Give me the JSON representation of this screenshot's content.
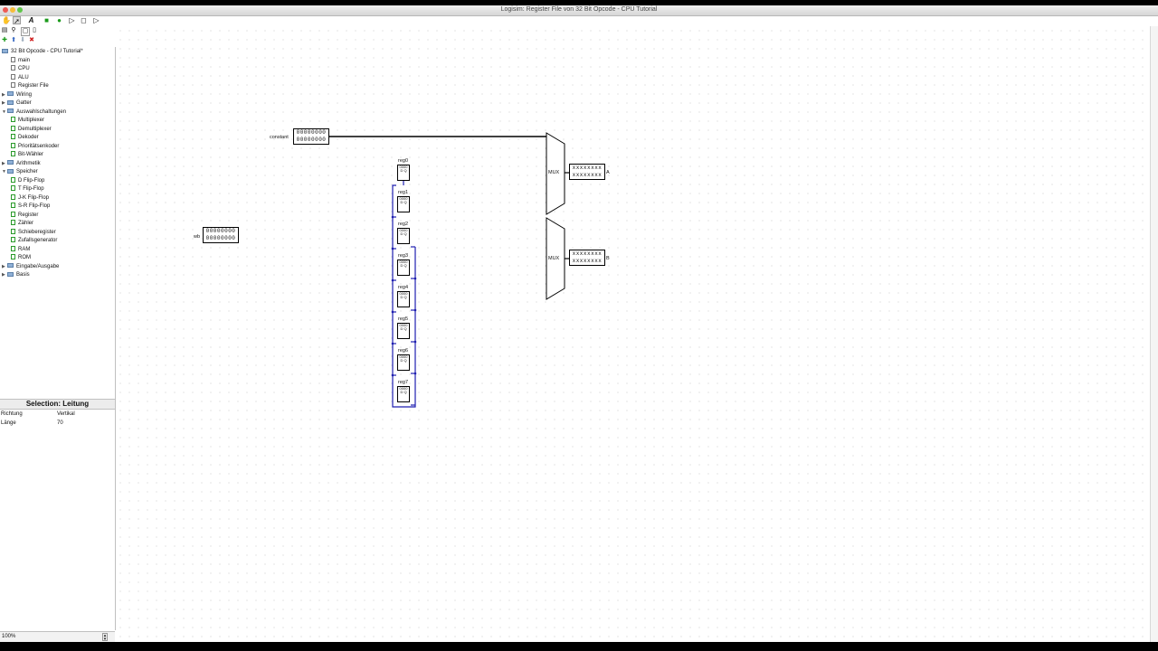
{
  "window": {
    "title": "Logisim: Register File von 32 Bit Opcode - CPU Tutorial"
  },
  "colors": {
    "close": "#ee5b55",
    "minimize": "#f6bd3a",
    "zoom": "#5fc64a",
    "wire": "#000000",
    "bus_wire": "#1f1fb0",
    "folder": "#8fb0d6"
  },
  "toolbar": [
    {
      "icon": "poke-hand-icon"
    },
    {
      "icon": "select-arrow-icon"
    },
    {
      "icon": "text-tool-icon"
    },
    {
      "icon": "input-pin-icon"
    },
    {
      "icon": "output-pin-icon"
    },
    {
      "icon": "not-gate-icon"
    },
    {
      "icon": "and-gate-icon"
    },
    {
      "icon": "or-gate-icon"
    }
  ],
  "explorer": {
    "items": [
      {
        "label": "32 Bit Opcode - CPU Tutorial*",
        "level": 0,
        "kind": "project",
        "expanded": true
      },
      {
        "label": "main",
        "level": 1,
        "kind": "circuit"
      },
      {
        "label": "CPU",
        "level": 1,
        "kind": "circuit"
      },
      {
        "label": "ALU",
        "level": 1,
        "kind": "circuit"
      },
      {
        "label": "Register File",
        "level": 1,
        "kind": "circuit-open"
      },
      {
        "label": "Wiring",
        "level": 0,
        "kind": "folder"
      },
      {
        "label": "Gatter",
        "level": 0,
        "kind": "folder"
      },
      {
        "label": "Auswahlschaltungen",
        "level": 0,
        "kind": "folder",
        "expanded": true
      },
      {
        "label": "Multiplexer",
        "level": 1,
        "kind": "component"
      },
      {
        "label": "Demultiplexer",
        "level": 1,
        "kind": "component"
      },
      {
        "label": "Dekoder",
        "level": 1,
        "kind": "component"
      },
      {
        "label": "Prioritätsenkoder",
        "level": 1,
        "kind": "component"
      },
      {
        "label": "Bit-Wähler",
        "level": 1,
        "kind": "component"
      },
      {
        "label": "Arithmetik",
        "level": 0,
        "kind": "folder"
      },
      {
        "label": "Speicher",
        "level": 0,
        "kind": "folder",
        "expanded": true
      },
      {
        "label": "D Flip-Flop",
        "level": 1,
        "kind": "component"
      },
      {
        "label": "T Flip-Flop",
        "level": 1,
        "kind": "component"
      },
      {
        "label": "J-K Flip-Flop",
        "level": 1,
        "kind": "component"
      },
      {
        "label": "S-R Flip-Flop",
        "level": 1,
        "kind": "component"
      },
      {
        "label": "Register",
        "level": 1,
        "kind": "component"
      },
      {
        "label": "Zähler",
        "level": 1,
        "kind": "component"
      },
      {
        "label": "Schieberegister",
        "level": 1,
        "kind": "component"
      },
      {
        "label": "Zufallsgenerator",
        "level": 1,
        "kind": "component"
      },
      {
        "label": "RAM",
        "level": 1,
        "kind": "component"
      },
      {
        "label": "ROM",
        "level": 1,
        "kind": "component"
      },
      {
        "label": "Eingabe/Ausgabe",
        "level": 0,
        "kind": "folder"
      },
      {
        "label": "Basis",
        "level": 0,
        "kind": "folder"
      }
    ]
  },
  "properties": {
    "header": "Selection: Leitung",
    "rows": [
      {
        "key": "Richtung",
        "value": "Vertikal"
      },
      {
        "key": "Länge",
        "value": "70"
      }
    ]
  },
  "zoom": "100%",
  "canvas": {
    "constant": {
      "label": "constant",
      "line1": "00000000",
      "line2": "00000000"
    },
    "wb": {
      "label": "wb",
      "line1": "00000000",
      "line2": "00000000"
    },
    "registers": [
      {
        "label": "reg0",
        "value": "0000"
      },
      {
        "label": "reg1",
        "value": "0000"
      },
      {
        "label": "reg2",
        "value": "0000"
      },
      {
        "label": "reg3",
        "value": "0000"
      },
      {
        "label": "reg4",
        "value": "0000"
      },
      {
        "label": "reg5",
        "value": "0000"
      },
      {
        "label": "reg6",
        "value": "0000"
      },
      {
        "label": "reg7",
        "value": "0000"
      }
    ],
    "muxes": [
      {
        "label": "MUX",
        "out_label": "A",
        "line1": "xxxxxxxx",
        "line2": "xxxxxxxx"
      },
      {
        "label": "MUX",
        "out_label": "B",
        "line1": "xxxxxxxx",
        "line2": "xxxxxxxx"
      }
    ]
  }
}
